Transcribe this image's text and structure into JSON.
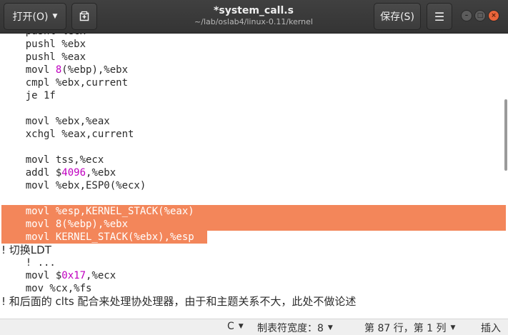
{
  "header": {
    "open_label": "打开(O)",
    "title": "*system_call.s",
    "subtitle": "~/lab/oslab4/linux-0.11/kernel",
    "save_label": "保存(S)"
  },
  "editor": {
    "lines": [
      {
        "text": "    pushl %ecx"
      },
      {
        "text": "    pushl %ebx"
      },
      {
        "text": "    pushl %eax"
      },
      {
        "pre": "    movl ",
        "num": "8",
        "post": "(%ebp),%ebx"
      },
      {
        "text": "    cmpl %ebx,current"
      },
      {
        "text": "    je 1f"
      },
      {
        "text": ""
      },
      {
        "text": "    movl %ebx,%eax"
      },
      {
        "text": "    xchgl %eax,current"
      },
      {
        "text": ""
      },
      {
        "text": "    movl tss,%ecx"
      },
      {
        "pre": "    addl $",
        "num": "4096",
        "post": ",%ebx"
      },
      {
        "text": "    movl %ebx,ESP0(%ecx)"
      },
      {
        "text": ""
      },
      {
        "text": "    movl %esp,KERNEL_STACK(%eax)",
        "selected": true
      },
      {
        "text": "    movl 8(%ebp),%ebx",
        "selected": true
      },
      {
        "text": "    movl KERNEL_STACK(%ebx),%esp",
        "selected": true
      },
      {
        "text": "! 切换LDT",
        "cjk": true
      },
      {
        "text": "    ! ..."
      },
      {
        "pre": "    movl $",
        "num": "0x17",
        "post": ",%ecx"
      },
      {
        "text": "    mov %cx,%fs"
      },
      {
        "text": "! 和后面的 clts 配合来处理协处理器，由于和主题关系不大，此处不做论述",
        "cjk": true
      }
    ]
  },
  "status": {
    "language": "C",
    "tab_width": "制表符宽度：8",
    "position": "第 87 行，第 1 列",
    "mode": "插入"
  }
}
